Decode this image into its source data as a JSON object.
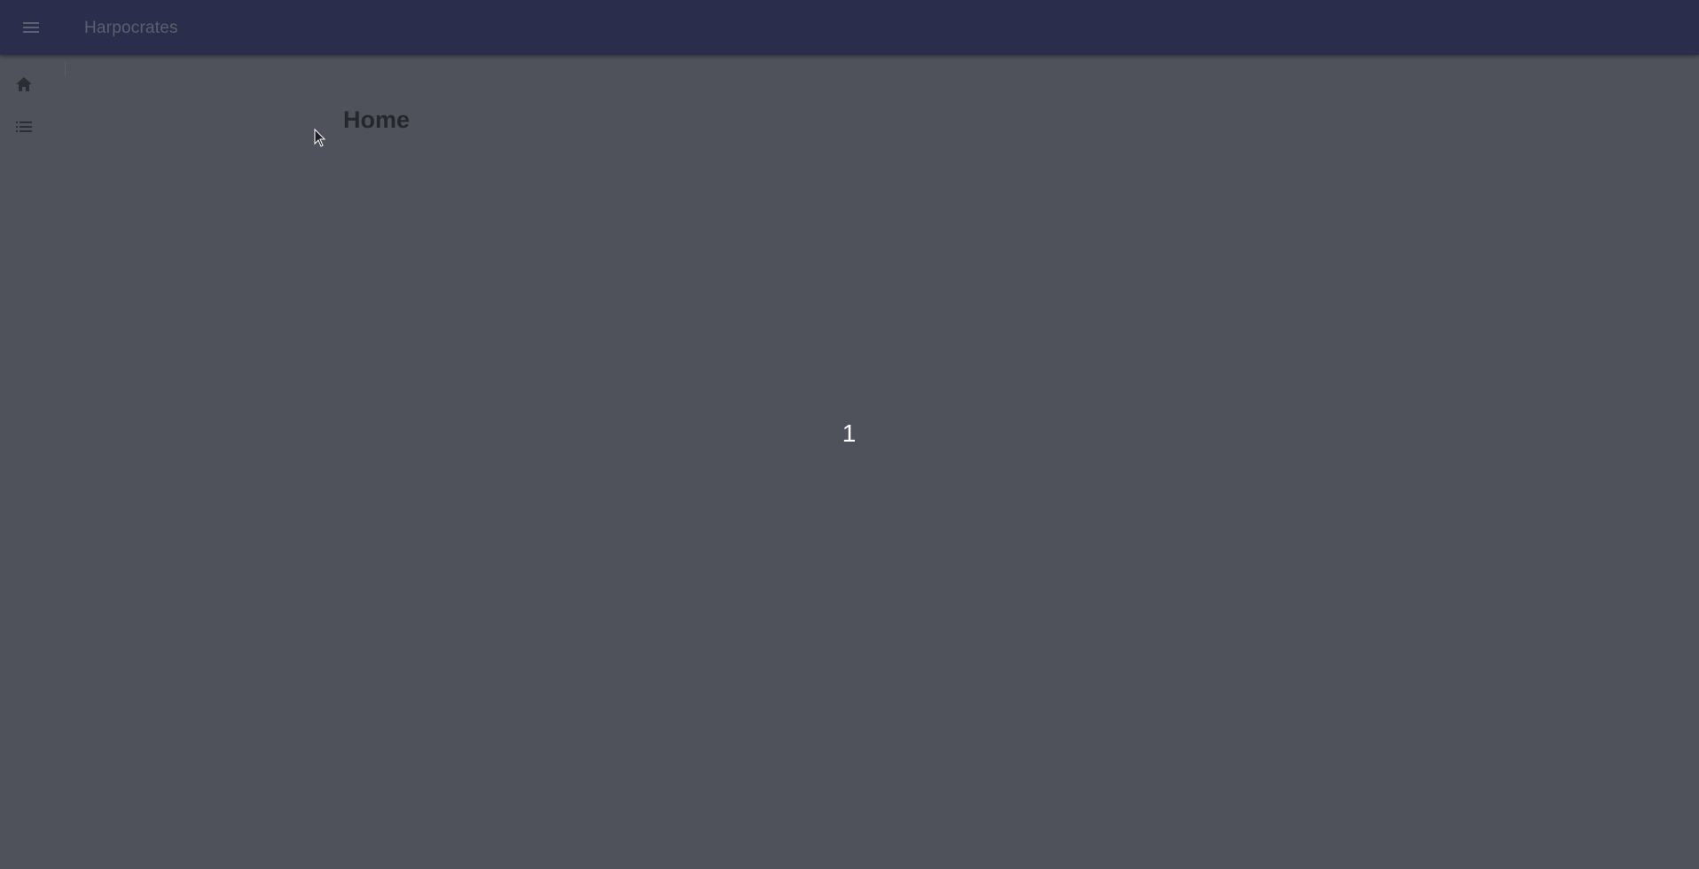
{
  "topbar": {
    "menu_icon": "menu-icon",
    "title": "Harpocrates"
  },
  "sidebar": {
    "items": [
      {
        "icon": "home-icon"
      },
      {
        "icon": "list-icon"
      }
    ]
  },
  "main": {
    "page_title": "Home",
    "center_value": "1"
  },
  "colors": {
    "topbar_bg": "#2a2e4c",
    "page_bg": "#4f525a",
    "title_text": "#5c5f6e",
    "heading_text": "#25272d",
    "value_text": "#ffffff"
  }
}
